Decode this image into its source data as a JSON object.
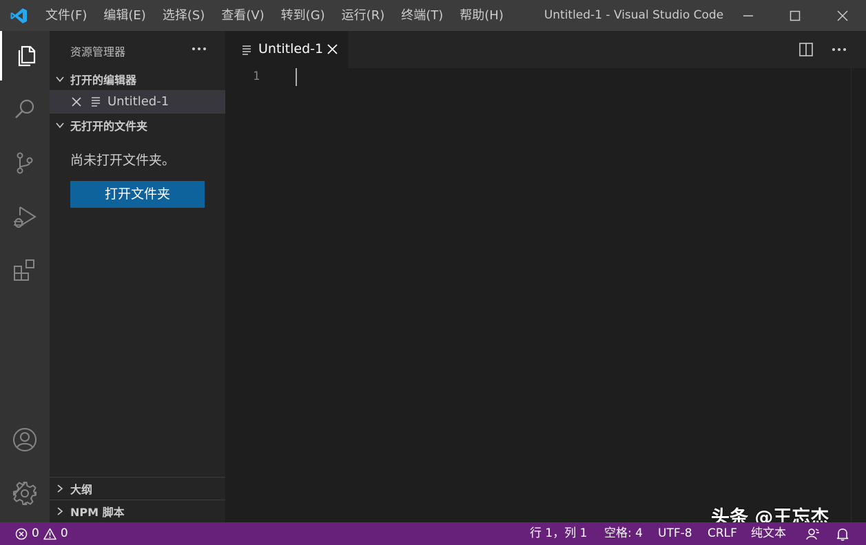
{
  "titlebar": {
    "menu": [
      {
        "label": "文件(F)"
      },
      {
        "label": "编辑(E)"
      },
      {
        "label": "选择(S)"
      },
      {
        "label": "查看(V)"
      },
      {
        "label": "转到(G)"
      },
      {
        "label": "运行(R)"
      },
      {
        "label": "终端(T)"
      },
      {
        "label": "帮助(H)"
      }
    ],
    "window_title": "Untitled-1 - Visual Studio Code"
  },
  "activitybar": {
    "items": [
      "explorer-icon",
      "search-icon",
      "source-control-icon",
      "run-debug-icon",
      "extensions-icon"
    ],
    "bottom": [
      "account-icon",
      "settings-gear-icon"
    ]
  },
  "sidebar": {
    "title": "资源管理器",
    "open_editors": {
      "header": "打开的编辑器",
      "items": [
        {
          "name": "Untitled-1"
        }
      ]
    },
    "no_folder": {
      "header": "无打开的文件夹",
      "message": "尚未打开文件夹。",
      "button": "打开文件夹"
    },
    "outline": {
      "header": "大纲"
    },
    "npm": {
      "header": "NPM 脚本"
    }
  },
  "editor": {
    "tabs": [
      {
        "label": "Untitled-1",
        "active": true
      }
    ],
    "line_numbers": [
      "1"
    ]
  },
  "statusbar": {
    "errors": "0",
    "warnings": "0",
    "position": "行 1，列 1",
    "indent": "空格: 4",
    "encoding": "UTF-8",
    "eol": "CRLF",
    "language": "纯文本",
    "accent_color": "#68217a"
  },
  "watermark": "头条 @王忘杰"
}
